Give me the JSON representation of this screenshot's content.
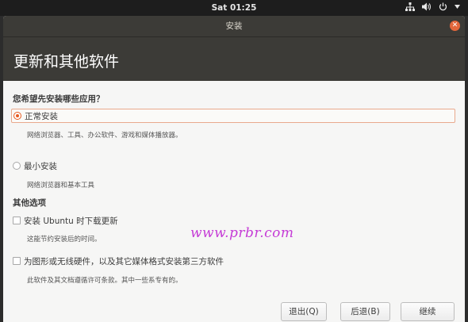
{
  "top_panel": {
    "clock": "Sat 01:25",
    "icons": [
      "network-icon",
      "volume-icon",
      "power-icon",
      "chevron-down-icon"
    ]
  },
  "window": {
    "title": "安装",
    "heading": "更新和其他软件"
  },
  "install_type": {
    "question": "您希望先安装哪些应用？",
    "options": [
      {
        "label": "正常安装",
        "description": "网络浏览器、工具、办公软件、游戏和媒体播放器。",
        "selected": true
      },
      {
        "label": "最小安装",
        "description": "网络浏览器和基本工具",
        "selected": false
      }
    ]
  },
  "other_options": {
    "heading": "其他选项",
    "items": [
      {
        "label": "安装 Ubuntu 时下载更新",
        "description": "这能节约安装后的时间。",
        "checked": false
      },
      {
        "label": "为图形或无线硬件，以及其它媒体格式安装第三方软件",
        "description": "此软件及其文档遵循许可条款。其中一些系专有的。",
        "checked": false
      }
    ]
  },
  "watermark": "www.prbr.com",
  "buttons": {
    "quit": "退出(Q)",
    "back": "后退(B)",
    "continue": "继续"
  },
  "colors": {
    "accent": "#e65a20",
    "header_bg": "#3c3b37",
    "close_button": "#e4673b"
  }
}
